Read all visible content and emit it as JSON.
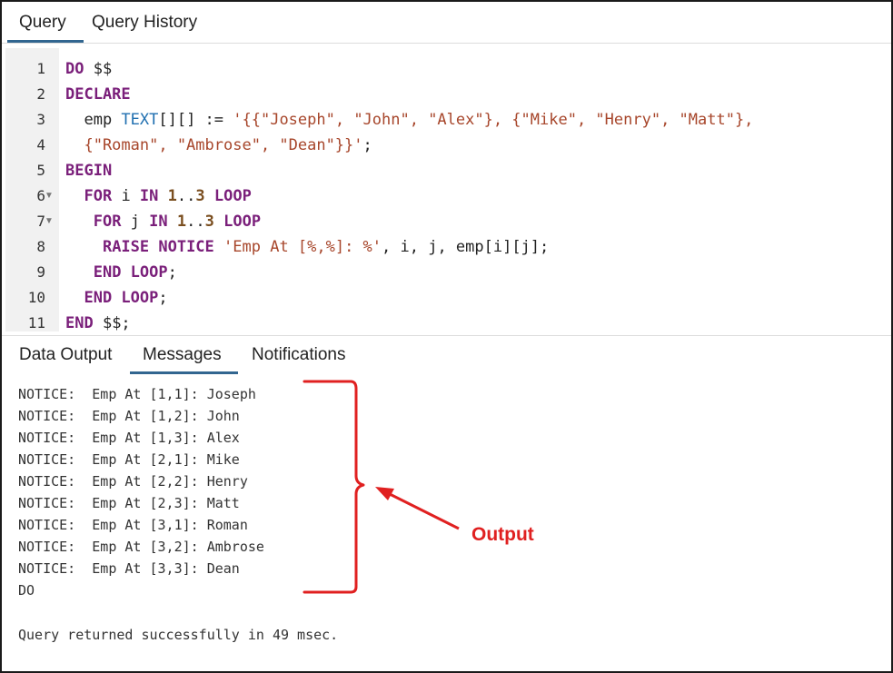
{
  "query_tabs": [
    {
      "label": "Query",
      "active": true
    },
    {
      "label": "Query History",
      "active": false
    }
  ],
  "editor": {
    "line_numbers": [
      "1",
      "2",
      "3",
      "4",
      "5",
      "6",
      "7",
      "8",
      "9",
      "10",
      "11"
    ],
    "fold_marker": "▼",
    "fold_lines": [
      6,
      7
    ],
    "lines": [
      [
        {
          "t": "DO",
          "c": "kw"
        },
        {
          "t": " $$",
          "c": ""
        }
      ],
      [
        {
          "t": "DECLARE",
          "c": "kw"
        }
      ],
      [
        {
          "t": "  emp ",
          "c": ""
        },
        {
          "t": "TEXT",
          "c": "ty"
        },
        {
          "t": "[][] := ",
          "c": ""
        },
        {
          "t": "'{{\"Joseph\", \"John\", \"Alex\"}, {\"Mike\", \"Henry\", \"Matt\"},",
          "c": "str"
        }
      ],
      [
        {
          "t": "  {\"Roman\", \"Ambrose\", \"Dean\"}}'",
          "c": "str"
        },
        {
          "t": ";",
          "c": ""
        }
      ],
      [
        {
          "t": "BEGIN",
          "c": "kw"
        }
      ],
      [
        {
          "t": "  ",
          "c": ""
        },
        {
          "t": "FOR",
          "c": "kw"
        },
        {
          "t": " i ",
          "c": ""
        },
        {
          "t": "IN",
          "c": "kw"
        },
        {
          "t": " ",
          "c": ""
        },
        {
          "t": "1",
          "c": "num"
        },
        {
          "t": "..",
          "c": ""
        },
        {
          "t": "3",
          "c": "num"
        },
        {
          "t": " ",
          "c": ""
        },
        {
          "t": "LOOP",
          "c": "kw"
        }
      ],
      [
        {
          "t": "   ",
          "c": ""
        },
        {
          "t": "FOR",
          "c": "kw"
        },
        {
          "t": " j ",
          "c": ""
        },
        {
          "t": "IN",
          "c": "kw"
        },
        {
          "t": " ",
          "c": ""
        },
        {
          "t": "1",
          "c": "num"
        },
        {
          "t": "..",
          "c": ""
        },
        {
          "t": "3",
          "c": "num"
        },
        {
          "t": " ",
          "c": ""
        },
        {
          "t": "LOOP",
          "c": "kw"
        }
      ],
      [
        {
          "t": "    ",
          "c": ""
        },
        {
          "t": "RAISE NOTICE",
          "c": "kw"
        },
        {
          "t": " ",
          "c": ""
        },
        {
          "t": "'Emp At [%,%]: %'",
          "c": "str"
        },
        {
          "t": ", i, j, emp[i][j];",
          "c": ""
        }
      ],
      [
        {
          "t": "   ",
          "c": ""
        },
        {
          "t": "END LOOP",
          "c": "kw"
        },
        {
          "t": ";",
          "c": ""
        }
      ],
      [
        {
          "t": "  ",
          "c": ""
        },
        {
          "t": "END LOOP",
          "c": "kw"
        },
        {
          "t": ";",
          "c": ""
        }
      ],
      [
        {
          "t": "END",
          "c": "kw"
        },
        {
          "t": " $$;",
          "c": ""
        }
      ]
    ]
  },
  "output_tabs": [
    {
      "label": "Data Output",
      "active": false
    },
    {
      "label": "Messages",
      "active": true
    },
    {
      "label": "Notifications",
      "active": false
    }
  ],
  "messages": [
    "NOTICE:  Emp At [1,1]: Joseph",
    "NOTICE:  Emp At [1,2]: John",
    "NOTICE:  Emp At [1,3]: Alex",
    "NOTICE:  Emp At [2,1]: Mike",
    "NOTICE:  Emp At [2,2]: Henry",
    "NOTICE:  Emp At [2,3]: Matt",
    "NOTICE:  Emp At [3,1]: Roman",
    "NOTICE:  Emp At [3,2]: Ambrose",
    "NOTICE:  Emp At [3,3]: Dean",
    "DO",
    "",
    "Query returned successfully in 49 msec."
  ],
  "annotation": {
    "label": "Output",
    "color": "#e02020"
  },
  "colors": {
    "active_tab_underline": "#326690",
    "keyword": "#7a1f7a",
    "type": "#1f6fb0",
    "string": "#a7462b",
    "number": "#7a4e1f",
    "gutter_bg": "#f1f1f1"
  }
}
